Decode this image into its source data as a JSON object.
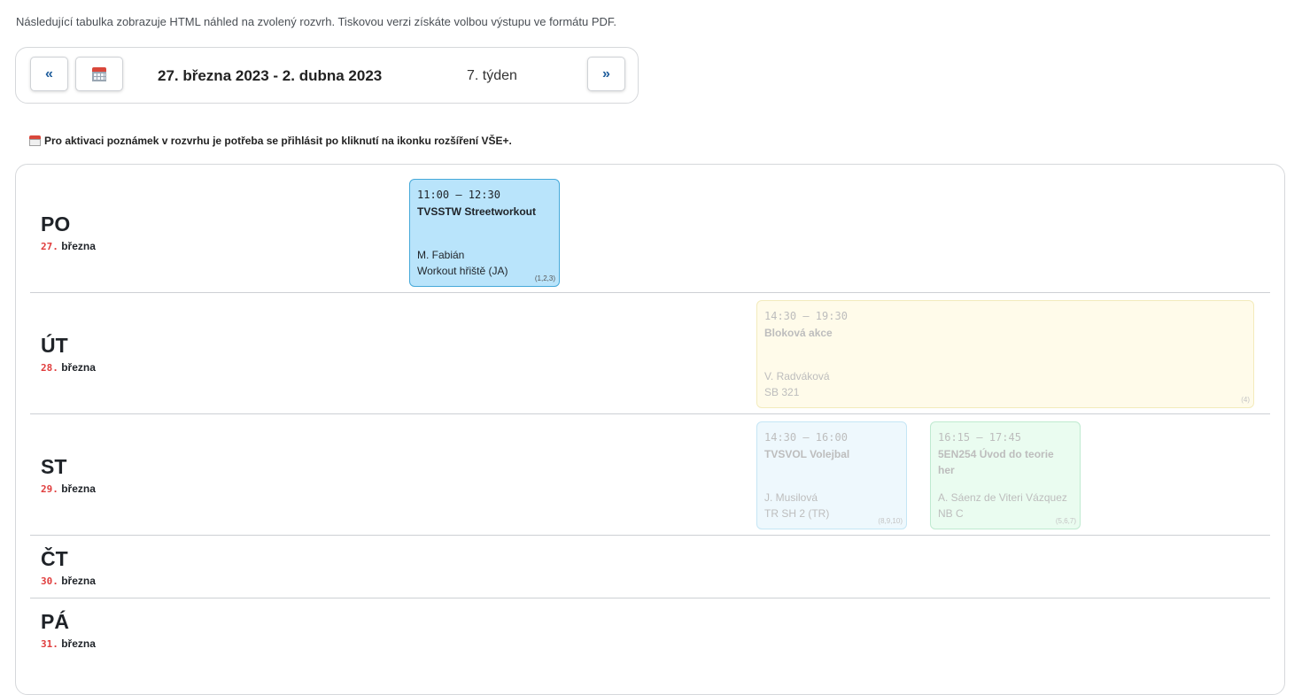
{
  "intro": "Následující tabulka zobrazuje HTML náhled na zvolený rozvrh. Tiskovou verzi získáte volbou výstupu ve formátu PDF.",
  "nav": {
    "prev_label": "«",
    "next_label": "»",
    "calendar_icon": "calendar-icon",
    "range": "27. března 2023 - 2. dubna 2023",
    "week": "7. týden"
  },
  "notice": {
    "icon": "calendar-icon",
    "text": "Pro aktivaci poznámek v rozvrhu je potřeba se přihlásit po kliknutí na ikonku rozšíření VŠE+."
  },
  "days": [
    {
      "abbr": "PO",
      "num": "27.",
      "month": "března"
    },
    {
      "abbr": "ÚT",
      "num": "28.",
      "month": "března"
    },
    {
      "abbr": "ST",
      "num": "29.",
      "month": "března"
    },
    {
      "abbr": "ČT",
      "num": "30.",
      "month": "března"
    },
    {
      "abbr": "PÁ",
      "num": "31.",
      "month": "března"
    }
  ],
  "events": [
    {
      "time": "11:00 – 12:30",
      "title": "TVSSTW Streetworkout",
      "teacher": "M. Fabián",
      "room": "Workout hřiště (JA)",
      "weeks": "(1,2,3)",
      "active": true,
      "color": "#b9e4fb"
    },
    {
      "time": "14:30 – 19:30",
      "title": "Bloková akce",
      "teacher": "V. Radváková",
      "room": "SB 321",
      "weeks": "(4)",
      "active": false,
      "color": "#fffbea"
    },
    {
      "time": "14:30 – 16:00",
      "title": "TVSVOL Volejbal",
      "teacher": "J. Musilová",
      "room": "TR SH 2 (TR)",
      "weeks": "(8,9,10)",
      "active": false,
      "color": "#eef8fd"
    },
    {
      "time": "16:15 – 17:45",
      "title": "5EN254 Úvod do teorie her",
      "teacher": "A. Sáenz de Viteri Vázquez",
      "room": "NB C",
      "weeks": "(5,6,7)",
      "active": false,
      "color": "#eafcf0"
    }
  ]
}
